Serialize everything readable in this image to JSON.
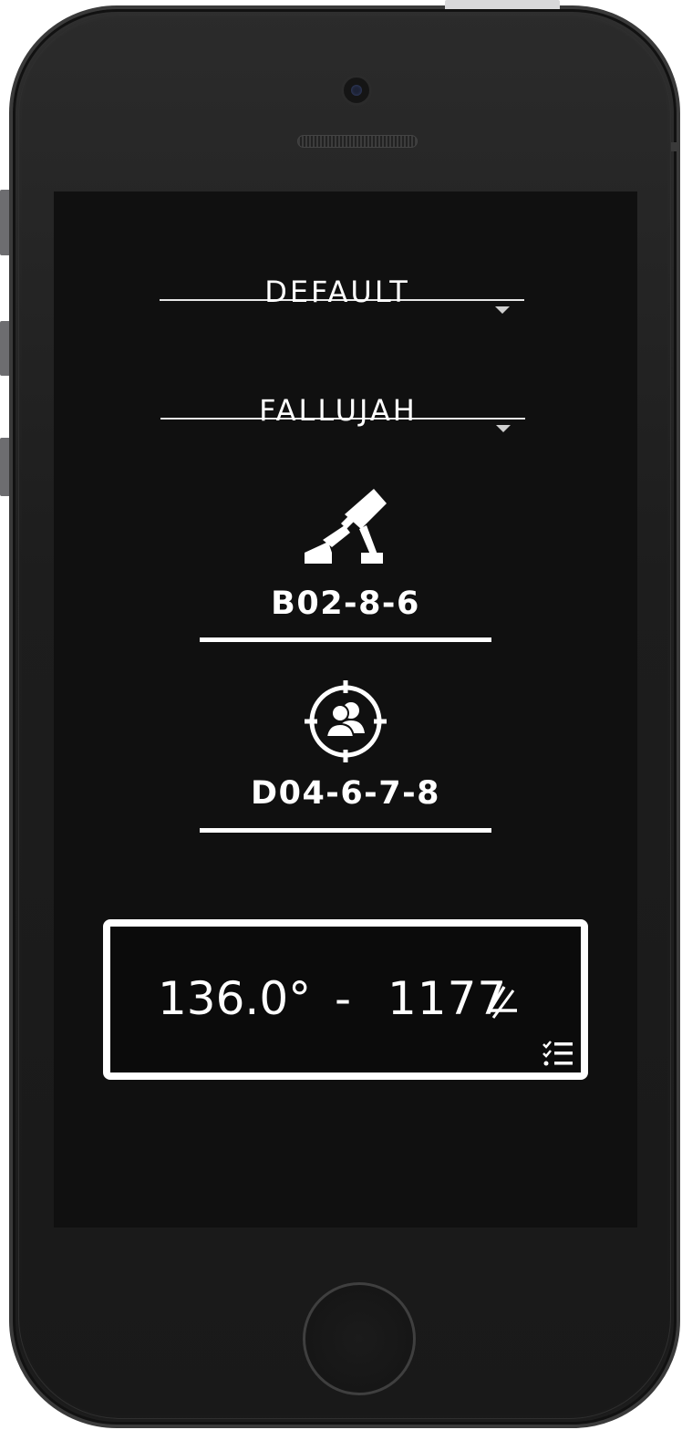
{
  "dropdowns": {
    "profile": {
      "value": "DEFAULT"
    },
    "map": {
      "value": "FALLUJAH"
    }
  },
  "mortar": {
    "icon": "mortar-icon",
    "grid": "B02-8-6"
  },
  "target": {
    "icon": "target-crosshair-group-icon",
    "grid": "D04-6-7-8"
  },
  "result": {
    "azimuth": "136.0°",
    "separator": "-",
    "range": "1177",
    "unit_icon": "mil-symbol-icon",
    "action_icon": "checklist-icon"
  },
  "colors": {
    "screen_bg": "#101010",
    "text": "#ffffff",
    "phone_body": "#1f1f1f"
  }
}
